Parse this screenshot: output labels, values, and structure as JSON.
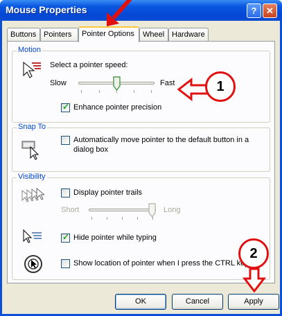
{
  "window": {
    "title": "Mouse Properties",
    "help_glyph": "?",
    "close_glyph": "✕"
  },
  "tabs": [
    {
      "label": "Buttons",
      "active": false
    },
    {
      "label": "Pointers",
      "active": false
    },
    {
      "label": "Pointer Options",
      "active": true
    },
    {
      "label": "Wheel",
      "active": false
    },
    {
      "label": "Hardware",
      "active": false
    }
  ],
  "motion": {
    "group_label": "Motion",
    "prompt": "Select a pointer speed:",
    "slow_label": "Slow",
    "fast_label": "Fast",
    "speed_fraction": 0.5,
    "enhance_label": "Enhance pointer precision",
    "enhance_checked": true
  },
  "snap_to": {
    "group_label": "Snap To",
    "line1": "Automatically move pointer to the default button in a",
    "line2": "dialog box",
    "checked": false
  },
  "visibility": {
    "group_label": "Visibility",
    "trails_label": "Display pointer trails",
    "trails_checked": false,
    "short_label": "Short",
    "long_label": "Long",
    "trail_fraction": 1.0,
    "hide_label": "Hide pointer while typing",
    "hide_checked": true,
    "ctrl_label": "Show location of pointer when I press the CTRL key",
    "ctrl_checked": false
  },
  "buttons": {
    "ok": "OK",
    "cancel": "Cancel",
    "apply": "Apply"
  },
  "callouts": {
    "one": "1",
    "two": "2",
    "color": "#e01010"
  }
}
